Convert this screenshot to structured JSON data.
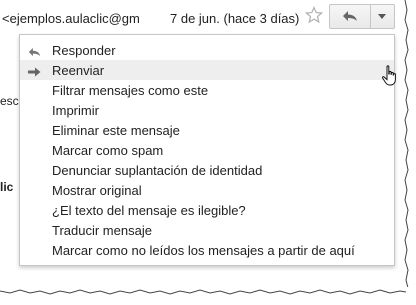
{
  "header": {
    "sender": "<ejemplos.aulaclic@gm",
    "date": "7 de jun. (hace 3 días)"
  },
  "background_snippets": {
    "left_1": "esc",
    "left_2": "lic"
  },
  "menu": {
    "items": [
      {
        "label": "Responder",
        "icon": "reply-icon",
        "highlighted": false
      },
      {
        "label": "Reenviar",
        "icon": "forward-icon",
        "highlighted": true
      },
      {
        "label": "Filtrar mensajes como este",
        "highlighted": false
      },
      {
        "label": "Imprimir",
        "highlighted": false
      },
      {
        "label": "Eliminar este mensaje",
        "highlighted": false
      },
      {
        "label": "Marcar como spam",
        "highlighted": false
      },
      {
        "label": "Denunciar suplantación de identidad",
        "highlighted": false
      },
      {
        "label": "Mostrar original",
        "highlighted": false
      },
      {
        "label": "¿El texto del mensaje es ilegible?",
        "highlighted": false
      },
      {
        "label": "Traducir mensaje",
        "highlighted": false
      },
      {
        "label": "Marcar como no leídos los mensajes a partir de aquí",
        "highlighted": false
      }
    ]
  },
  "colors": {
    "text": "#222222",
    "highlight": "#eeeeee",
    "border": "#c6c6c6",
    "icon": "#777777"
  }
}
